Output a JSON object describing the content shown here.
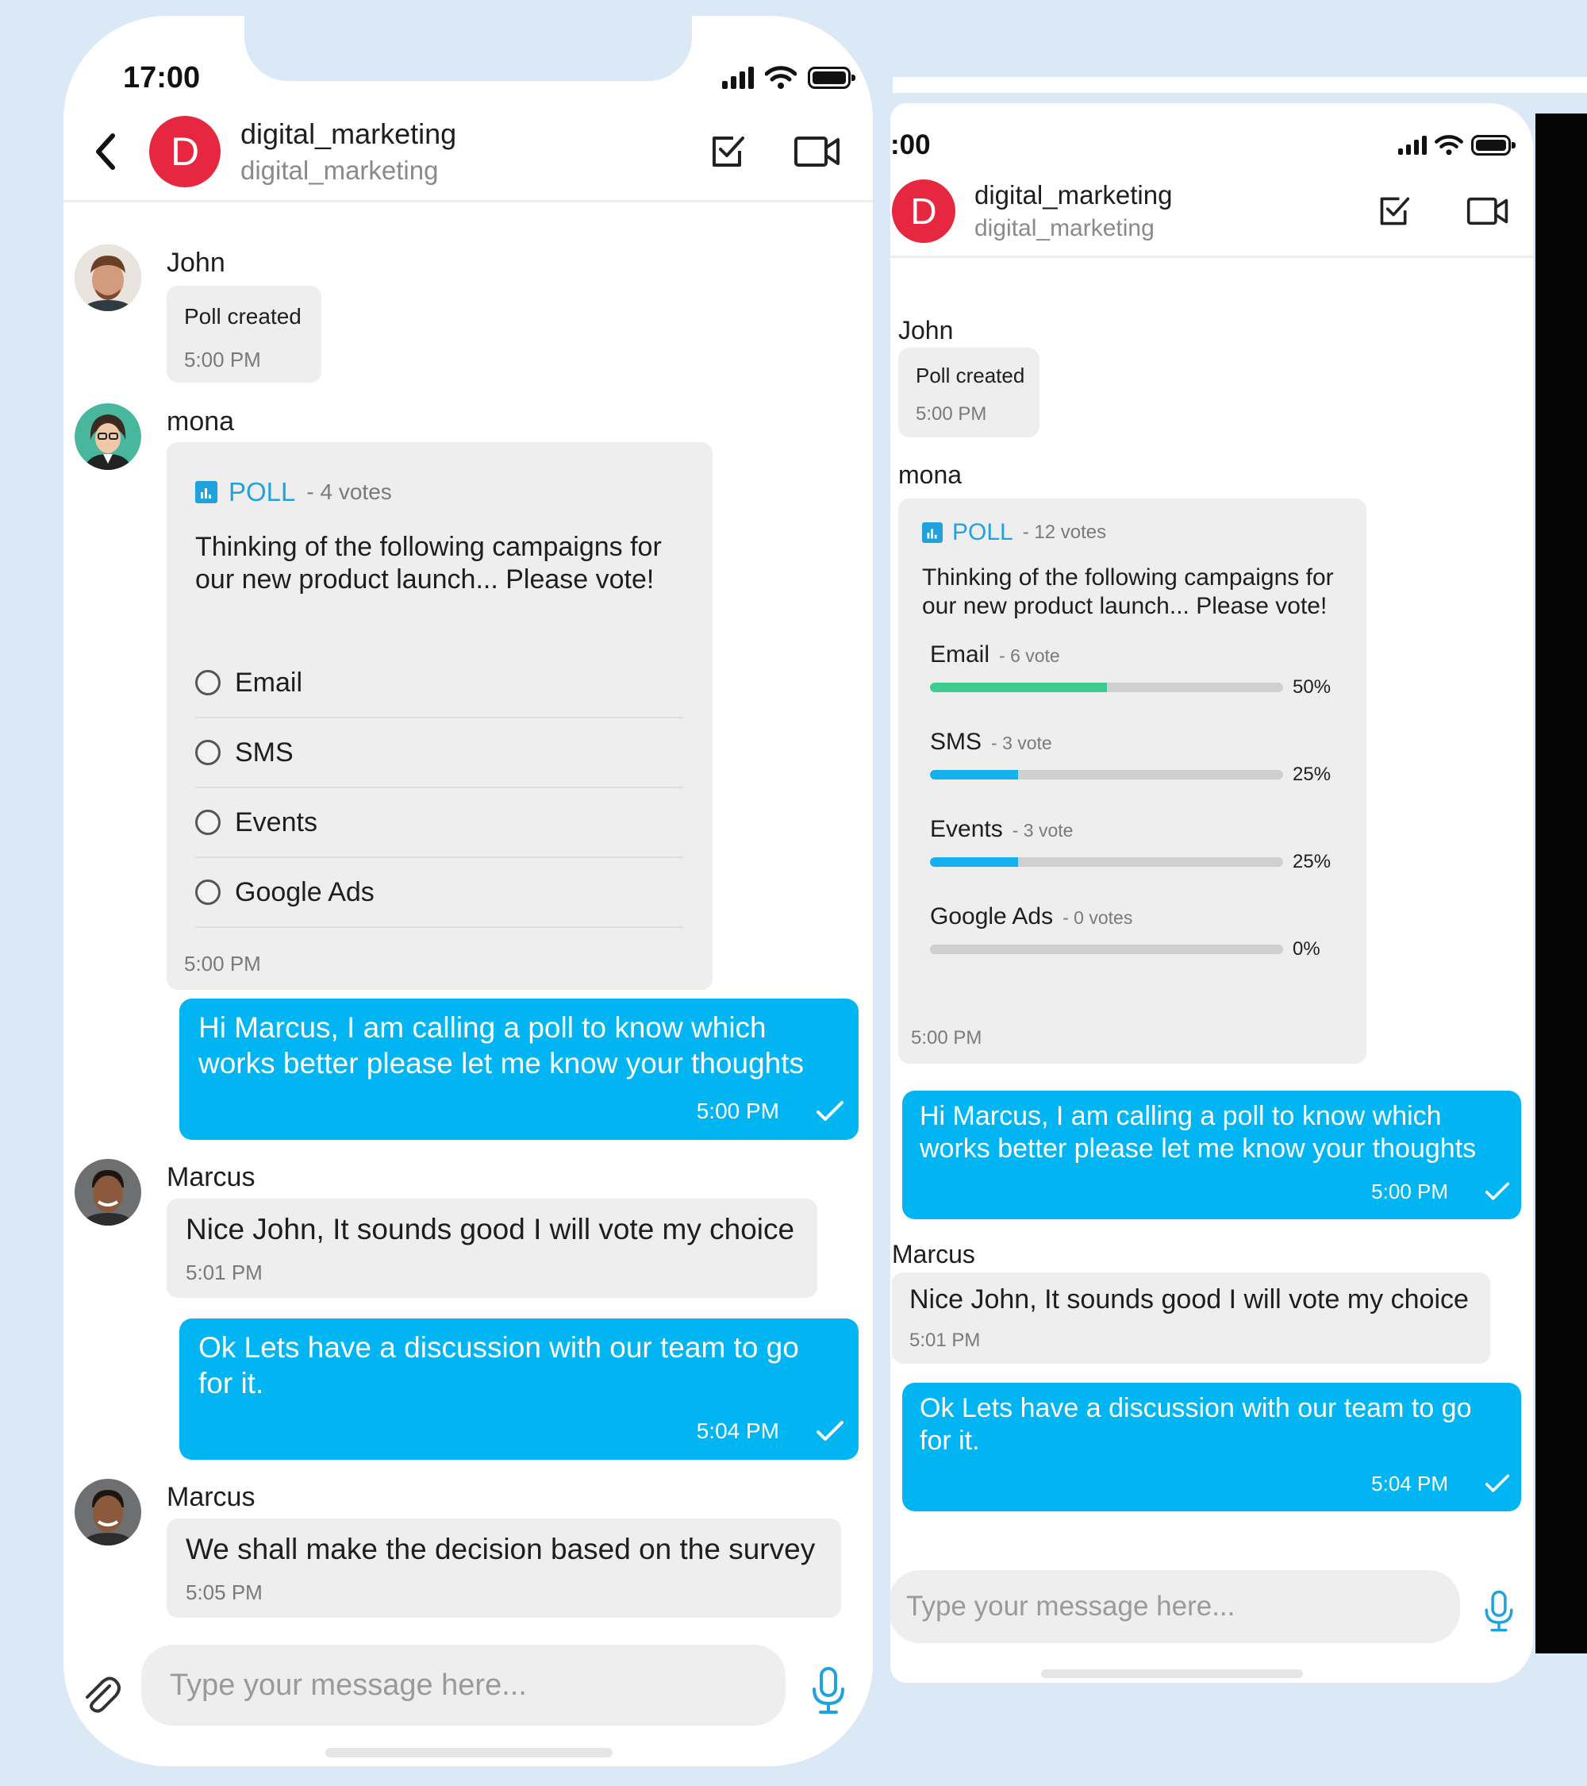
{
  "left_phone": {
    "status": {
      "time": "17:00"
    },
    "header": {
      "avatar_letter": "D",
      "title": "digital_marketing",
      "subtitle": "digital_marketing"
    },
    "messages": {
      "m1": {
        "sender": "John",
        "text": "Poll created",
        "time": "5:00 PM"
      },
      "m2": {
        "sender": "mona",
        "poll_label": "POLL",
        "poll_count": "- 4 votes",
        "question": "Thinking of the following campaigns for our new product launch... Please vote!",
        "options": [
          "Email",
          "SMS",
          "Events",
          "Google Ads"
        ],
        "time": "5:00 PM"
      },
      "m3": {
        "text": "Hi Marcus, I am calling a poll to know which works better please let me know your thoughts",
        "time": "5:00 PM"
      },
      "m4": {
        "sender": "Marcus",
        "text": "Nice John, It sounds good I will vote my choice",
        "time": "5:01 PM"
      },
      "m5": {
        "text": "Ok Lets have a discussion with our team to go for it.",
        "time": "5:04 PM"
      },
      "m6": {
        "sender": "Marcus",
        "text": "We shall make the decision based on the survey",
        "time": "5:05 PM"
      }
    },
    "composer": {
      "placeholder": "Type your message here..."
    }
  },
  "right_phone": {
    "status": {
      "time": ":00"
    },
    "header": {
      "avatar_letter": "D",
      "title": "digital_marketing",
      "subtitle": "digital_marketing"
    },
    "messages": {
      "m1": {
        "sender": "John",
        "text": "Poll created",
        "time": "5:00 PM"
      },
      "m2": {
        "sender": "mona",
        "poll_label": "POLL",
        "poll_count": "- 12 votes",
        "question": "Thinking of the following campaigns for our new product launch... Please vote!",
        "results": [
          {
            "name": "Email",
            "votes": "- 6 vote",
            "percent_label": "50%",
            "fraction": 0.5,
            "color": "#3ecb8f"
          },
          {
            "name": "SMS",
            "votes": "- 3 vote",
            "percent_label": "25%",
            "fraction": 0.25,
            "color": "#14b1ee"
          },
          {
            "name": "Events",
            "votes": "- 3 vote",
            "percent_label": "25%",
            "fraction": 0.25,
            "color": "#14b1ee"
          },
          {
            "name": "Google Ads",
            "votes": "- 0 votes",
            "percent_label": "0%",
            "fraction": 0,
            "color": "#14b1ee"
          }
        ],
        "time": "5:00 PM"
      },
      "m3": {
        "text": "Hi Marcus, I am calling a poll to know which works better please let me know your thoughts",
        "time": "5:00 PM"
      },
      "m4": {
        "sender": "Marcus",
        "text": "Nice John, It sounds good I will vote my choice",
        "time": "5:01 PM"
      },
      "m5": {
        "text": "Ok Lets have a discussion with our team to go for it.",
        "time": "5:04 PM"
      }
    },
    "composer": {
      "placeholder": "Type your message here..."
    }
  },
  "colors": {
    "accent": "#00b5f2",
    "poll_blue": "#22a2dc",
    "avatar_red": "#e7273f",
    "bubble_gray": "#eeeeee",
    "email_bar": "#3ecb8f",
    "background": "#dbe8f6"
  },
  "icons": [
    "back-chevron-icon",
    "checkbox-icon",
    "video-call-icon",
    "paperclip-icon",
    "microphone-icon",
    "poll-chart-icon",
    "read-tick-icon",
    "signal-icon",
    "wifi-icon",
    "battery-icon"
  ]
}
